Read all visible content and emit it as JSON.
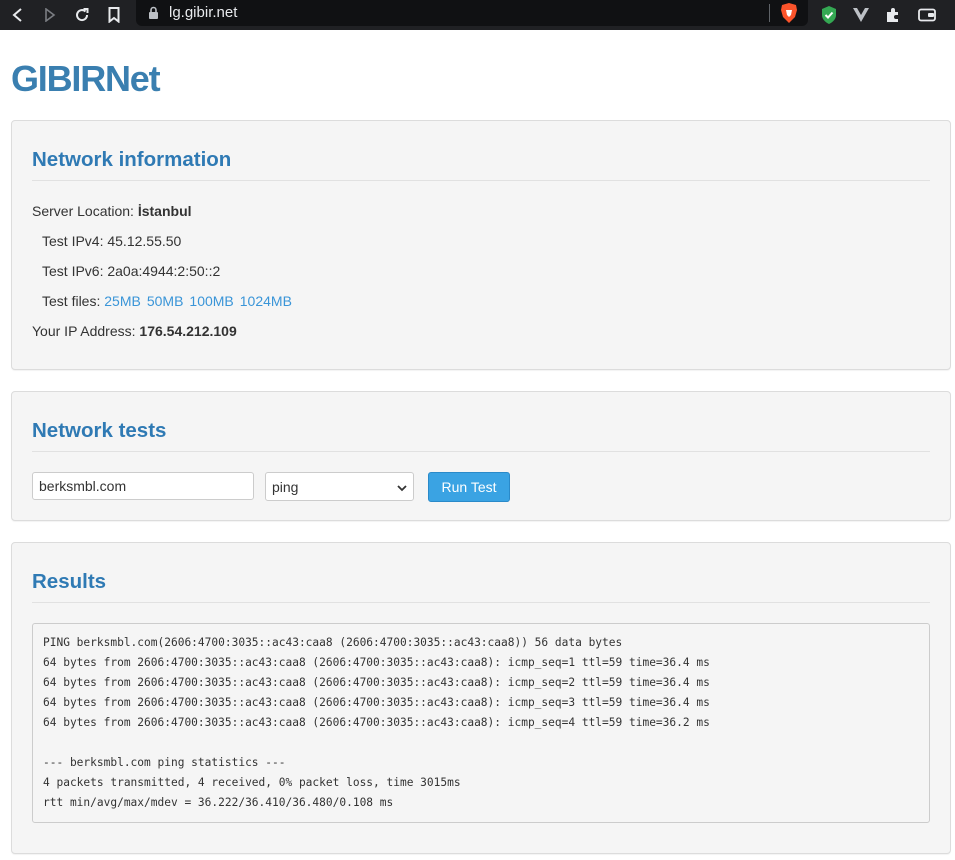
{
  "browser": {
    "url": "lg.gibir.net",
    "icons": [
      "back-icon",
      "forward-icon",
      "reload-icon",
      "bookmark-icon",
      "lock-icon",
      "brave-shield-icon",
      "security-check-icon",
      "vpn-icon",
      "extensions-icon",
      "wallet-icon"
    ]
  },
  "site": {
    "logo": "GIBIRNet"
  },
  "network_info": {
    "title": "Network information",
    "server_location_label": "Server Location:",
    "server_location_value": "İstanbul",
    "ipv4_label": "Test IPv4:",
    "ipv4_value": "45.12.55.50",
    "ipv6_label": "Test IPv6:",
    "ipv6_value": "2a0a:4944:2:50::2",
    "files_label": "Test files:",
    "files": [
      "25MB",
      "50MB",
      "100MB",
      "1024MB"
    ],
    "your_ip_label": "Your IP Address:",
    "your_ip_value": "176.54.212.109"
  },
  "network_tests": {
    "title": "Network tests",
    "host_value": "berksmbl.com",
    "test_selected": "ping",
    "run_label": "Run Test"
  },
  "results": {
    "title": "Results",
    "output": "PING berksmbl.com(2606:4700:3035::ac43:caa8 (2606:4700:3035::ac43:caa8)) 56 data bytes\n64 bytes from 2606:4700:3035::ac43:caa8 (2606:4700:3035::ac43:caa8): icmp_seq=1 ttl=59 time=36.4 ms\n64 bytes from 2606:4700:3035::ac43:caa8 (2606:4700:3035::ac43:caa8): icmp_seq=2 ttl=59 time=36.4 ms\n64 bytes from 2606:4700:3035::ac43:caa8 (2606:4700:3035::ac43:caa8): icmp_seq=3 ttl=59 time=36.4 ms\n64 bytes from 2606:4700:3035::ac43:caa8 (2606:4700:3035::ac43:caa8): icmp_seq=4 ttl=59 time=36.2 ms\n\n--- berksmbl.com ping statistics ---\n4 packets transmitted, 4 received, 0% packet loss, time 3015ms\nrtt min/avg/max/mdev = 36.222/36.410/36.480/0.108 ms"
  },
  "colors": {
    "brand": "#3a7fb0",
    "heading": "#2f7ab4",
    "link": "#3a95d8",
    "button": "#3aa3e3",
    "panel": "#f5f5f5"
  }
}
